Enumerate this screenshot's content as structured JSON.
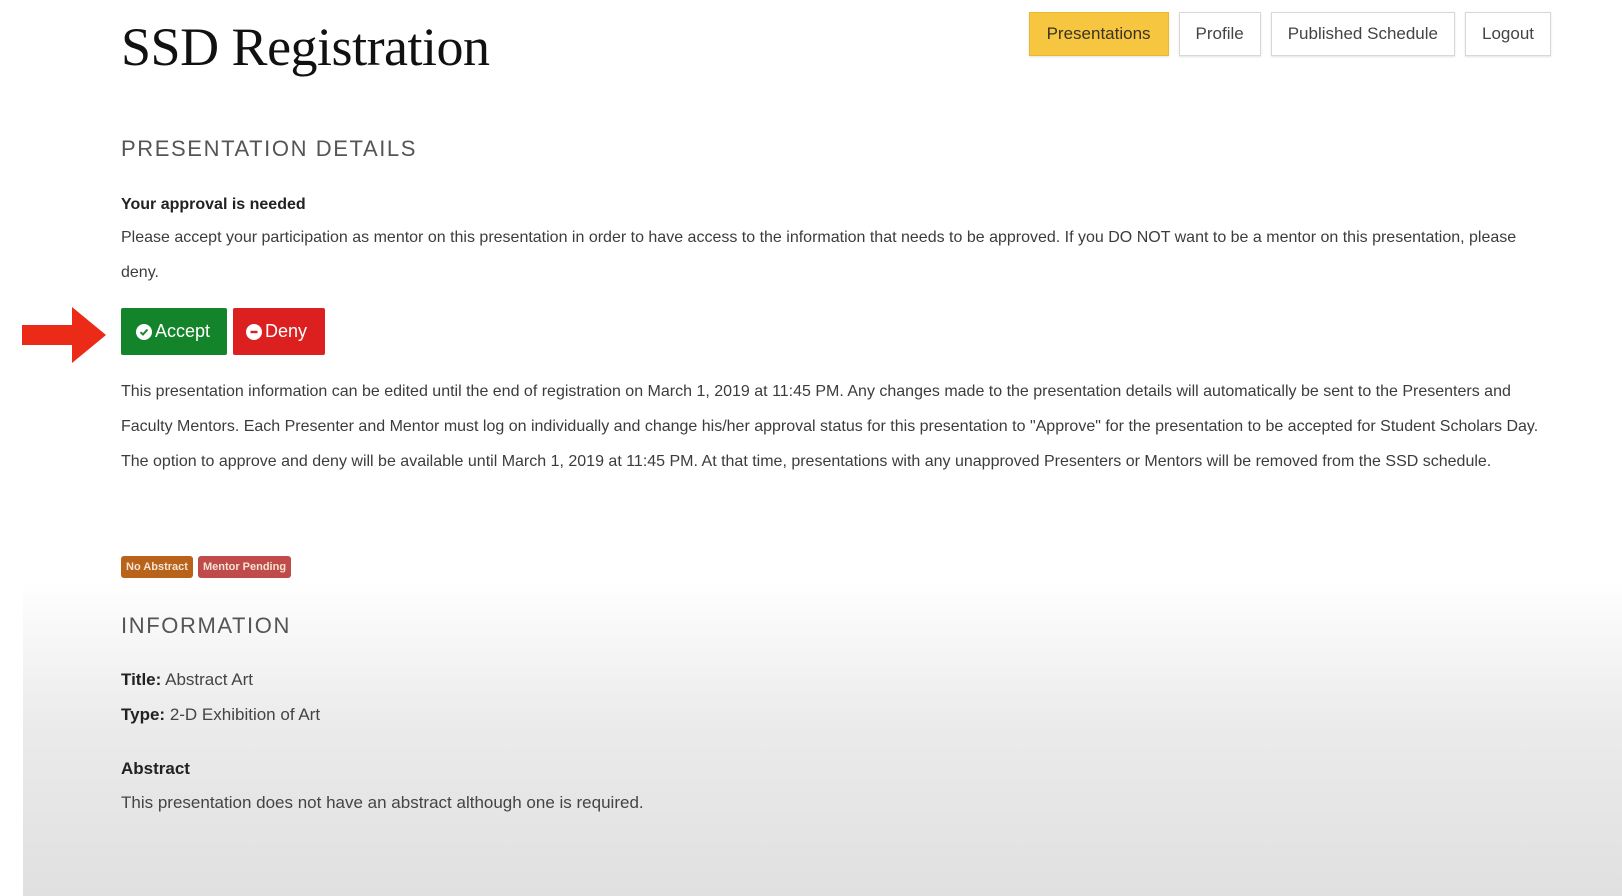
{
  "header": {
    "app_title": "SSD Registration",
    "nav": {
      "presentations": "Presentations",
      "profile": "Profile",
      "published_schedule": "Published Schedule",
      "logout": "Logout"
    }
  },
  "details": {
    "heading": "PRESENTATION DETAILS",
    "approval_title": "Your approval is needed",
    "approval_text": "Please accept your participation as mentor on this presentation in order to have access to the information that needs to be approved. If you DO NOT want to be a mentor on this presentation, please deny.",
    "accept_label": "Accept",
    "deny_label": "Deny",
    "info_text": "This presentation information can be edited until the end of registration on March 1, 2019 at 11:45 PM. Any changes made to the presentation details will automatically be sent to the Presenters and Faculty Mentors. Each Presenter and Mentor must log on individually and change his/her approval status for this presentation to \"Approve\" for the presentation to be accepted for Student Scholars Day. The option to approve and deny will be available until March 1, 2019 at 11:45 PM. At that time, presentations with any unapproved Presenters or Mentors will be removed from the SSD schedule.",
    "badges": {
      "no_abstract": "No Abstract",
      "mentor_pending": "Mentor Pending"
    }
  },
  "information": {
    "heading": "INFORMATION",
    "title_label": "Title:",
    "title_value": "Abstract Art",
    "type_label": "Type:",
    "type_value": "2-D Exhibition of Art",
    "abstract_heading": "Abstract",
    "abstract_text": "This presentation does not have an abstract although one is required."
  },
  "colors": {
    "nav_active": "#f6c640",
    "accept": "#14842a",
    "deny": "#dc1f1f",
    "badge_no_abstract": "#b8621a",
    "badge_mentor_pending": "#c04b4b",
    "annotation_arrow": "#ec2a18"
  },
  "icons": {
    "accept": "check-circle-icon",
    "deny": "minus-circle-icon",
    "annotation": "red-arrow-icon"
  }
}
